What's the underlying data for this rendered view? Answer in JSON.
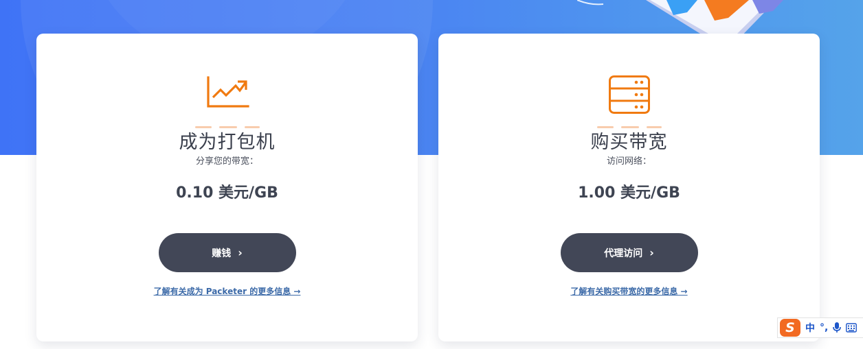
{
  "cards": [
    {
      "title": "成为打包机",
      "subtitle": "分享您的带宽：",
      "price": "0.10 美元/GB",
      "button_label": "赚钱",
      "button_chevron": "›",
      "link_text": "了解有关成为 Packeter 的更多信息 →",
      "icon": "chart-trend-up-icon"
    },
    {
      "title": "购买带宽",
      "subtitle": "访问网络：",
      "price": "1.00 美元/GB",
      "button_label": "代理访问",
      "button_chevron": "›",
      "link_text": "了解有关购买带宽的更多信息 →",
      "icon": "server-icon"
    }
  ],
  "ime_toolbar": {
    "logo": "S",
    "mode": "中",
    "punct": "°,"
  },
  "colors": {
    "hero_blue": "#4a82f3",
    "accent_orange": "#f07a10",
    "button_dark": "#424757",
    "link_blue": "#3c6aa8"
  }
}
